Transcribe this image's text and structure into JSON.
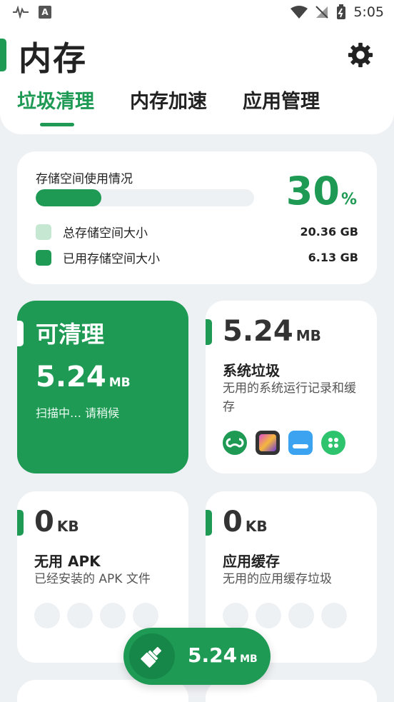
{
  "status_bar": {
    "time": "5:05",
    "a_label": "A"
  },
  "header": {
    "title": "内存",
    "tabs": [
      {
        "label": "垃圾清理",
        "active": true
      },
      {
        "label": "内存加速",
        "active": false
      },
      {
        "label": "应用管理",
        "active": false
      }
    ]
  },
  "storage": {
    "label": "存储空间使用情况",
    "used_percent": 30,
    "percent_value": "30",
    "percent_unit": "%",
    "total_label": "总存储空间大小",
    "total_value": "20.36 GB",
    "used_label": "已用存储空间大小",
    "used_value": "6.13 GB"
  },
  "cleanable": {
    "title": "可清理",
    "size": "5.24",
    "unit": "MB",
    "status": "扫描中… 请稍候"
  },
  "system_junk": {
    "size": "5.24",
    "unit": "MB",
    "title": "系统垃圾",
    "desc": "无用的系统运行记录和缓存"
  },
  "apk": {
    "size": "0",
    "unit": "KB",
    "title": "无用 APK",
    "desc": "已经安装的 APK 文件"
  },
  "app_cache": {
    "size": "0",
    "unit": "KB",
    "title": "应用缓存",
    "desc": "无用的应用缓存垃圾"
  },
  "fab": {
    "size": "5.24",
    "unit": "MB"
  },
  "colors": {
    "accent": "#1e9a55",
    "background": "#eef1f4",
    "legend_total": "#c6e8d3"
  }
}
